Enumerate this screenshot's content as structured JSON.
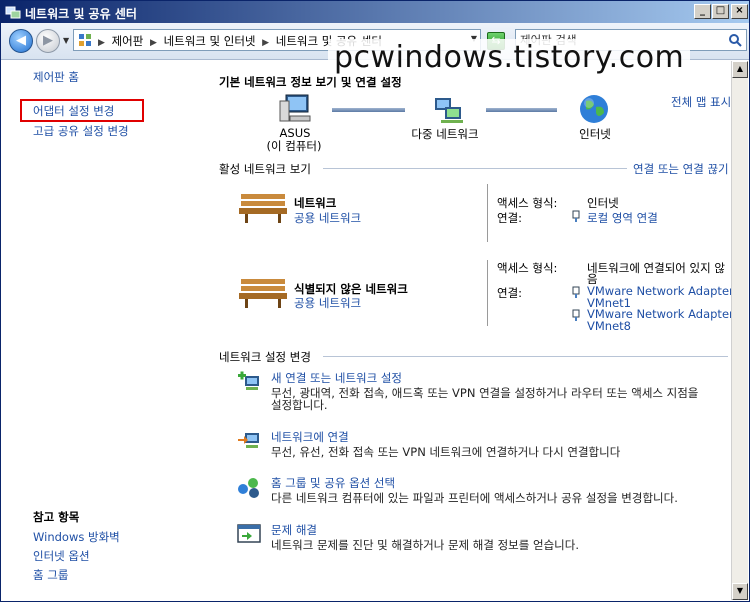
{
  "window": {
    "title": "네트워크 및 공유 센터",
    "controls": {
      "minimize": "_",
      "maximize": "□",
      "close": "×"
    }
  },
  "address_bar": {
    "crumbs": [
      "제어판",
      "네트워크 및 인터넷",
      "네트워크 및 공유 센터"
    ]
  },
  "search": {
    "placeholder": "제어판 검색"
  },
  "watermark": "pcwindows.tistory.com",
  "sidebar": {
    "home": "제어판 홈",
    "adapter_settings": "어댑터 설정 변경",
    "advanced_sharing": "고급 공유 설정 변경",
    "see_also_title": "참고 항목",
    "see_also": [
      "Windows 방화벽",
      "인터넷 옵션",
      "홈 그룹"
    ]
  },
  "main": {
    "heading": "기본 네트워크 정보 보기 및 연결 설정",
    "full_map": "전체 맵 표시",
    "map": {
      "computer_name": "ASUS",
      "computer_sub": "(이 컴퓨터)",
      "network_label": "다중 네트워크",
      "internet_label": "인터넷"
    },
    "active_title": "활성 네트워크 보기",
    "connect_disconnect": "연결 또는 연결 끊기",
    "networks": [
      {
        "name": "네트워크",
        "type": "공용 네트워크",
        "access_label": "액세스 형식:",
        "access_value": "인터넷",
        "conn_label": "연결:",
        "connections": [
          "로컬 영역 연결"
        ]
      },
      {
        "name": "식별되지 않은 네트워크",
        "type": "공용 네트워크",
        "access_label": "액세스 형식:",
        "access_value_1": "네트워크에 연결되어 있지 않",
        "access_value_2": "음",
        "conn_label": "연결:",
        "connections": [
          {
            "line1": "VMware Network Adapter",
            "line2": "VMnet1"
          },
          {
            "line1": "VMware Network Adapter",
            "line2": "VMnet8"
          }
        ]
      }
    ],
    "change_title": "네트워크 설정 변경",
    "tasks": [
      {
        "title": "새 연결 또는 네트워크 설정",
        "desc1": "무선, 광대역, 전화 접속, 애드혹 또는 VPN 연결을 설정하거나 라우터 또는 액세스 지점을",
        "desc2": "설정합니다."
      },
      {
        "title": "네트워크에 연결",
        "desc1": "무선, 유선, 전화 접속 또는 VPN 네트워크에 연결하거나 다시 연결합니다"
      },
      {
        "title": "홈 그룹 및 공유 옵션 선택",
        "desc1": "다른 네트워크 컴퓨터에 있는 파일과 프린터에 액세스하거나 공유 설정을 변경합니다."
      },
      {
        "title": "문제 해결",
        "desc1": "네트워크 문제를 진단 및 해결하거나 문제 해결 정보를 얻습니다."
      }
    ]
  }
}
